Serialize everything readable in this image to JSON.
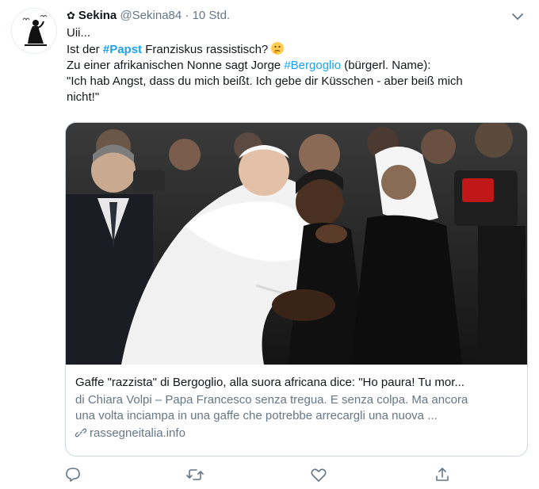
{
  "tweet": {
    "author": {
      "name": "Sekina",
      "handle": "@Sekina84",
      "separator": "·",
      "time": "10 Std.",
      "name_prefix_icon": "flower-icon",
      "avatar_icon": "praying-figure-avatar-icon"
    },
    "menu_icon": "chevron-down-icon",
    "text": {
      "line1": "Uii...",
      "line2_pre": "Ist der ",
      "line2_hashtag": "#Papst",
      "line2_post": " Franziskus rassistisch?",
      "line2_emoji": "thinking-face-icon",
      "line3_pre": "Zu einer afrikanischen Nonne sagt Jorge ",
      "line3_hashtag": "#Bergoglio",
      "line3_post": " (bürgerl. Name):",
      "line4": "\"Ich hab Angst, dass du mich beißt. Ich gebe dir Küsschen - aber beiß mich",
      "line5": "nicht!\""
    },
    "card": {
      "image_alt": "Pope Francis greeting a nun in a crowd",
      "title": "Gaffe \"razzista\" di Bergoglio, alla suora africana dice: \"Ho paura! Tu mor...",
      "description_line1": "di Chiara Volpi – Papa Francesco senza tregua. E senza colpa. Ma ancora",
      "description_line2": "una volta inciampa in una gaffe che potrebbe arrecargli una nuova ...",
      "domain": "rassegneitalia.info",
      "domain_icon": "link-icon"
    },
    "actions": [
      {
        "name": "reply-icon"
      },
      {
        "name": "retweet-icon"
      },
      {
        "name": "like-icon"
      },
      {
        "name": "share-icon"
      }
    ],
    "colors": {
      "accent": "#1da1f2",
      "text": "#14171a",
      "muted": "#657786",
      "border": "#ccd6dd"
    }
  }
}
